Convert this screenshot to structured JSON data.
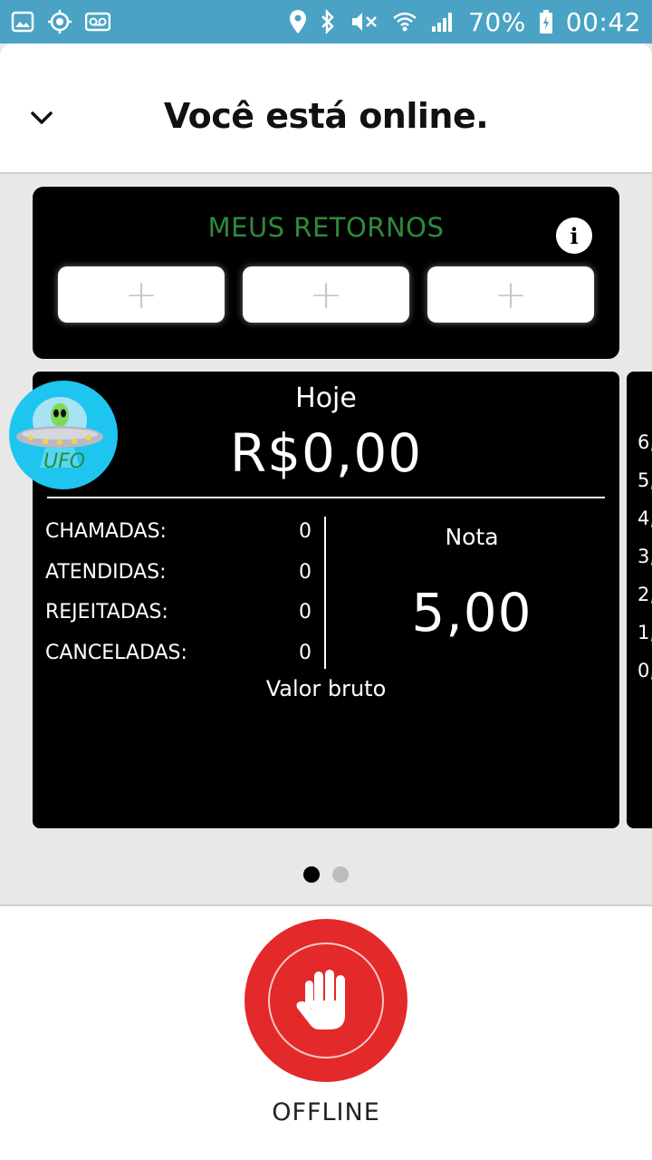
{
  "status_bar": {
    "battery_percent": "70%",
    "time": "00:42",
    "icons": [
      "gallery-icon",
      "sync-icon",
      "voicemail-icon",
      "location-icon",
      "bluetooth-icon",
      "mute-icon",
      "wifi-icon",
      "signal-icon",
      "battery-icon"
    ]
  },
  "header": {
    "title": "Você está online."
  },
  "retornos": {
    "title": "MEUS RETORNOS",
    "info_label": "i",
    "slots": [
      "+",
      "+",
      "+"
    ]
  },
  "today": {
    "label": "Hoje",
    "amount": "R$0,00",
    "stats": [
      {
        "label": "CHAMADAS:",
        "value": "0"
      },
      {
        "label": "ATENDIDAS:",
        "value": "0"
      },
      {
        "label": "REJEITADAS:",
        "value": "0"
      },
      {
        "label": "CANCELADAS:",
        "value": "0"
      }
    ],
    "nota_label": "Nota",
    "nota_value": "5,00",
    "valor_bruto": "Valor bruto"
  },
  "avatar": {
    "text": "UFO"
  },
  "next_card": {
    "labels": [
      "6,",
      "5,",
      "4,",
      "3,",
      "2,",
      "1,",
      "0,"
    ]
  },
  "pager": {
    "total": 2,
    "active": 0
  },
  "bottom": {
    "offline_label": "OFFLINE"
  },
  "colors": {
    "status_bar": "#4aa3c4",
    "accent_green": "#2f8a3b",
    "offline_red": "#e4292b",
    "avatar_bg": "#1ec6ef"
  }
}
